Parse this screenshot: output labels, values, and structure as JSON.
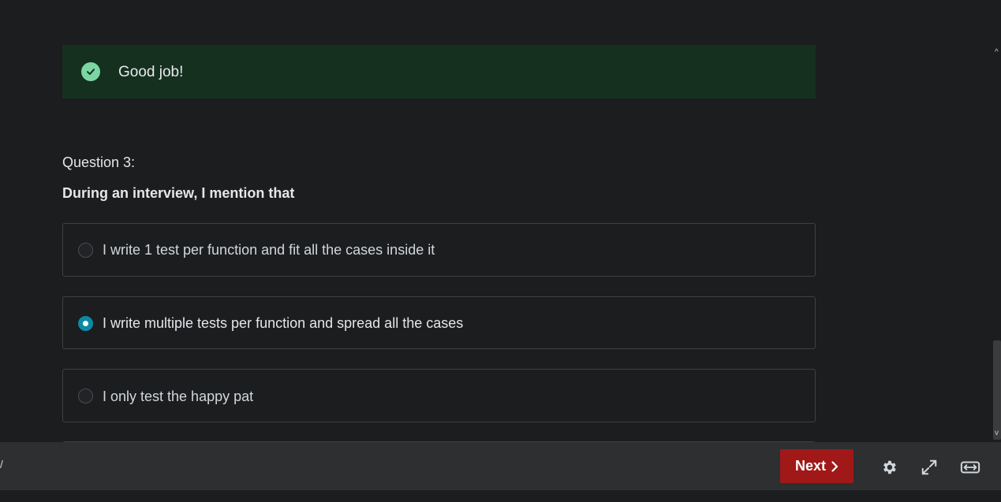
{
  "feedback": {
    "message": "Good job!",
    "icon": "check-circle-icon",
    "color": "#7ad7a4"
  },
  "question": {
    "label": "Question 3:",
    "text": "During an interview, I mention that",
    "options": [
      {
        "label": "I write 1 test per function and fit all the cases inside it",
        "selected": false
      },
      {
        "label": "I write multiple tests per function and spread all the cases",
        "selected": true
      },
      {
        "label": "I only test the happy pat",
        "selected": false
      }
    ]
  },
  "footer": {
    "left_mark": "/",
    "next_label": "Next",
    "next_color": "#a01818",
    "tools": [
      "gear-icon",
      "expand-icon",
      "fit-width-icon"
    ]
  },
  "colors": {
    "background": "#1c1d1f",
    "footer_bg": "#2d2f31",
    "accent_radio": "#0c8aa3"
  }
}
